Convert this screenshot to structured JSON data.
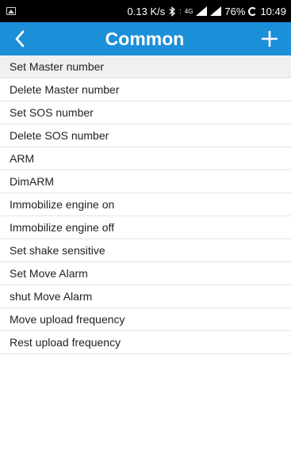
{
  "status_bar": {
    "net_speed": "0.13 K/s",
    "network_type": "4G",
    "battery": "76%",
    "time": "10:49",
    "icons": [
      "image-notification-icon",
      "bluetooth-icon",
      "signal-icon",
      "battery-loading-icon"
    ]
  },
  "header": {
    "title": "Common",
    "background_color": "#1c8fd9"
  },
  "commands": [
    {
      "label": "Set Master number"
    },
    {
      "label": "Delete Master number"
    },
    {
      "label": "Set SOS number"
    },
    {
      "label": "Delete SOS number"
    },
    {
      "label": "ARM"
    },
    {
      "label": "DimARM"
    },
    {
      "label": "Immobilize engine on"
    },
    {
      "label": "Immobilize engine off"
    },
    {
      "label": "Set shake sensitive"
    },
    {
      "label": "Set Move Alarm"
    },
    {
      "label": "shut Move Alarm"
    },
    {
      "label": "Move upload frequency"
    },
    {
      "label": "Rest upload frequency"
    }
  ]
}
